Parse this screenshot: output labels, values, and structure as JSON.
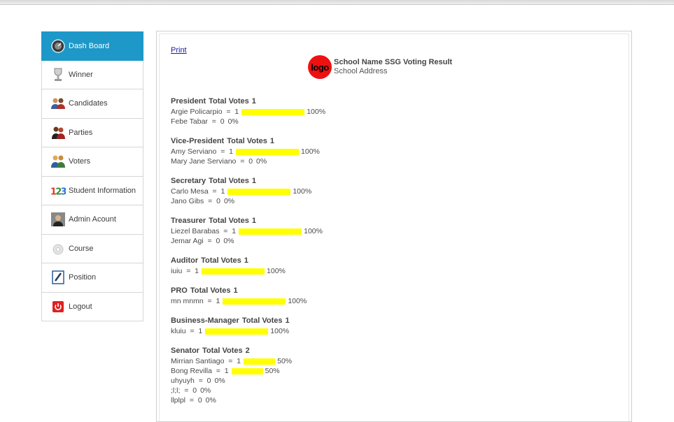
{
  "sidebar": {
    "items": [
      {
        "label": "Dash Board",
        "icon": "dashboard-gauge-icon",
        "active": true
      },
      {
        "label": "Winner",
        "icon": "trophy-icon",
        "active": false
      },
      {
        "label": "Candidates",
        "icon": "users-pair-icon",
        "active": false
      },
      {
        "label": "Parties",
        "icon": "people-group-icon",
        "active": false
      },
      {
        "label": "Voters",
        "icon": "voters-icon",
        "active": false
      },
      {
        "label": "Student Information",
        "icon": "numbers-123-icon",
        "active": false
      },
      {
        "label": "Admin Acount",
        "icon": "admin-photo-icon",
        "active": false
      },
      {
        "label": "Course",
        "icon": "course-gear-icon",
        "active": false
      },
      {
        "label": "Position",
        "icon": "edit-pen-icon",
        "active": false
      },
      {
        "label": "Logout",
        "icon": "power-icon",
        "active": false
      }
    ]
  },
  "print_label": "Print",
  "header": {
    "logo_text": "logo",
    "school_name": "School Name SSG Voting Result",
    "school_address": "School Address"
  },
  "colors": {
    "accent": "#1d98c8",
    "bar": "#ffff00",
    "logo": "#ee1111"
  },
  "positions": [
    {
      "name": "President",
      "total_label": "Total Votes",
      "total": "1",
      "candidates": [
        {
          "name": "Argie Policarpio",
          "votes": "1",
          "percent": 100,
          "percent_text": "100%"
        },
        {
          "name": "Febe Tabar",
          "votes": "0",
          "percent": 0,
          "percent_text": "0%"
        }
      ]
    },
    {
      "name": "Vice-President",
      "total_label": "Total Votes",
      "total": "1",
      "candidates": [
        {
          "name": "Amy Serviano",
          "votes": "1",
          "percent": 100,
          "percent_text": "100%"
        },
        {
          "name": "Mary Jane Serviano",
          "votes": "0",
          "percent": 0,
          "percent_text": "0%"
        }
      ]
    },
    {
      "name": "Secretary",
      "total_label": "Total Votes",
      "total": "1",
      "candidates": [
        {
          "name": "Carlo Mesa",
          "votes": "1",
          "percent": 100,
          "percent_text": "100%"
        },
        {
          "name": "Jano Gibs",
          "votes": "0",
          "percent": 0,
          "percent_text": "0%"
        }
      ]
    },
    {
      "name": "Treasurer",
      "total_label": "Total Votes",
      "total": "1",
      "candidates": [
        {
          "name": "Liezel Barabas",
          "votes": "1",
          "percent": 100,
          "percent_text": "100%"
        },
        {
          "name": "Jemar Agi",
          "votes": "0",
          "percent": 0,
          "percent_text": "0%"
        }
      ]
    },
    {
      "name": "Auditor",
      "total_label": "Total Votes",
      "total": "1",
      "candidates": [
        {
          "name": "iuiu",
          "votes": "1",
          "percent": 100,
          "percent_text": "100%"
        }
      ]
    },
    {
      "name": "PRO",
      "total_label": "Total Votes",
      "total": "1",
      "candidates": [
        {
          "name": "mn mnmn",
          "votes": "1",
          "percent": 100,
          "percent_text": "100%"
        }
      ]
    },
    {
      "name": "Business-Manager",
      "total_label": "Total Votes",
      "total": "1",
      "candidates": [
        {
          "name": "kluiu",
          "votes": "1",
          "percent": 100,
          "percent_text": "100%"
        }
      ]
    },
    {
      "name": "Senator",
      "total_label": "Total Votes",
      "total": "2",
      "candidates": [
        {
          "name": "Mirrian Santiago",
          "votes": "1",
          "percent": 50,
          "percent_text": "50%"
        },
        {
          "name": "Bong Revilla",
          "votes": "1",
          "percent": 50,
          "percent_text": "50%"
        },
        {
          "name": "uhyuyh",
          "votes": "0",
          "percent": 0,
          "percent_text": "0%"
        },
        {
          "name": ";l;l;",
          "votes": "0",
          "percent": 0,
          "percent_text": "0%"
        },
        {
          "name": "llplpl",
          "votes": "0",
          "percent": 0,
          "percent_text": "0%"
        }
      ]
    }
  ]
}
